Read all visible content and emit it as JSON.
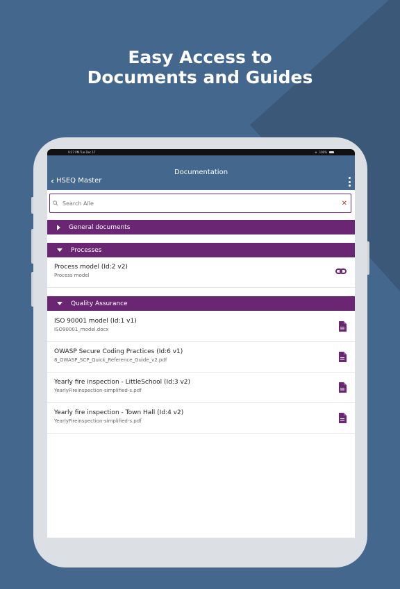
{
  "headline": {
    "line1": "Easy Access to",
    "line2": "Documents and Guides"
  },
  "status_bar": {
    "time": "9:27 PM  Tue Dec 17",
    "battery": "100%"
  },
  "nav": {
    "title": "Documentation",
    "back_label": "HSEQ Master"
  },
  "search": {
    "placeholder": "Search Alle"
  },
  "sections": [
    {
      "label": "General documents",
      "expanded": false
    },
    {
      "label": "Processes",
      "expanded": true
    },
    {
      "label": "Quality Assurance",
      "expanded": true
    }
  ],
  "processes": [
    {
      "title": "Process model (Id:2 v2)",
      "subtitle": "Process model",
      "icon": "link-icon"
    }
  ],
  "quality": [
    {
      "title": "ISO 90001 model (Id:1 v1)",
      "subtitle": "ISO90001_model.docx",
      "icon": "document-icon"
    },
    {
      "title": "OWASP Secure Coding Practices (Id:6 v1)",
      "subtitle": "8_OWASP_SCP_Quick_Reference_Guide_v2.pdf",
      "icon": "document-icon"
    },
    {
      "title": "Yearly fire inspection - LittleSchool (Id:3 v2)",
      "subtitle": "YearlyFireinspection-simplified-s.pdf",
      "icon": "document-icon"
    },
    {
      "title": "Yearly fire inspection - Town Hall (Id:4 v2)",
      "subtitle": "YearlyFireinspection-simplified-s.pdf",
      "icon": "document-icon"
    }
  ],
  "colors": {
    "background": "#44678d",
    "accent": "#6a2573",
    "nav": "#44678d"
  }
}
